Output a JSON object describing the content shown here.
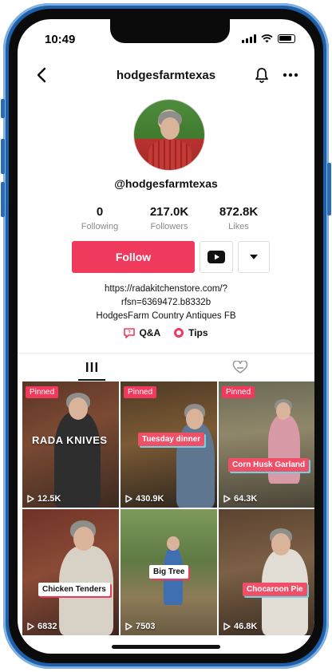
{
  "status_bar": {
    "time": "10:49"
  },
  "header": {
    "title": "hodgesfarmtexas"
  },
  "profile": {
    "username": "@hodgesfarmtexas",
    "stats": [
      {
        "value": "0",
        "label": "Following"
      },
      {
        "value": "217.0K",
        "label": "Followers"
      },
      {
        "value": "872.8K",
        "label": "Likes"
      }
    ],
    "follow_label": "Follow",
    "bio_lines": [
      "https://radakitchenstore.com/?",
      "rfsn=6369472.b8332b",
      "HodgesFarm Country Antiques FB"
    ],
    "links": [
      {
        "label": "Q&A",
        "icon": "qa-icon"
      },
      {
        "label": "Tips",
        "icon": "tips-icon"
      }
    ]
  },
  "colors": {
    "accent": "#ef3a5d",
    "caption_shadow": "#6fd3e6",
    "frame": "#1d5fa8"
  },
  "tiles": [
    {
      "pinned": "Pinned",
      "overlay": "RADA KNIVES",
      "caption": "",
      "views": "12.5K"
    },
    {
      "pinned": "Pinned",
      "overlay": "",
      "caption": "Tuesday dinner",
      "views": "430.9K"
    },
    {
      "pinned": "Pinned",
      "overlay": "",
      "caption": "Corn Husk Garland",
      "views": "64.3K"
    },
    {
      "pinned": "",
      "overlay": "",
      "caption": "Chicken Tenders",
      "views": "6832"
    },
    {
      "pinned": "",
      "overlay": "",
      "caption": "Big Tree",
      "views": "7503"
    },
    {
      "pinned": "",
      "overlay": "",
      "caption": "Chocaroon Pie",
      "views": "46.8K"
    }
  ]
}
